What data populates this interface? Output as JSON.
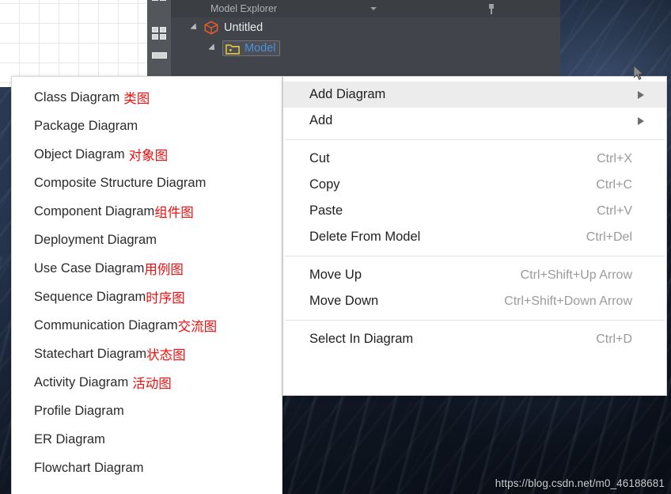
{
  "window": {
    "explorer": {
      "title": "Model Explorer",
      "caret_icon": "chevron-down-icon",
      "pin_icon": "pin-icon",
      "toolbar_icons": [
        "grid-view-icon",
        "grid-view-icon",
        "list-view-icon"
      ],
      "tree": [
        {
          "label": "Untitled",
          "icon": "cube-icon",
          "expanded": true,
          "selected": false
        },
        {
          "label": "Model",
          "icon": "folder-icon",
          "expanded": true,
          "selected": true
        }
      ]
    }
  },
  "diagram_submenu": {
    "name": "Add Diagram submenu",
    "items": [
      {
        "en": "Class Diagram",
        "zh": "类图",
        "space": true
      },
      {
        "en": "Package Diagram",
        "zh": "",
        "space": false
      },
      {
        "en": "Object Diagram",
        "zh": "对象图",
        "space": true
      },
      {
        "en": "Composite Structure Diagram",
        "zh": "",
        "space": false
      },
      {
        "en": "Component Diagram",
        "zh": "组件图",
        "space": false
      },
      {
        "en": "Deployment Diagram",
        "zh": "",
        "space": false
      },
      {
        "en": "Use Case Diagram",
        "zh": "用例图",
        "space": false
      },
      {
        "en": "Sequence Diagram",
        "zh": "时序图",
        "space": false
      },
      {
        "en": "Communication Diagram",
        "zh": "交流图",
        "space": false
      },
      {
        "en": "Statechart Diagram",
        "zh": "状态图",
        "space": false
      },
      {
        "en": "Activity Diagram",
        "zh": "活动图",
        "space": true
      },
      {
        "en": "Profile Diagram",
        "zh": "",
        "space": false
      },
      {
        "en": "ER Diagram",
        "zh": "",
        "space": false
      },
      {
        "en": "Flowchart Diagram",
        "zh": "",
        "space": false
      }
    ]
  },
  "context_menu": {
    "name": "model element context menu",
    "groups": [
      {
        "items": [
          {
            "label": "Add Diagram",
            "shortcut": "",
            "submenu": true,
            "highlighted": true
          },
          {
            "label": "Add",
            "shortcut": "",
            "submenu": true,
            "highlighted": false
          }
        ]
      },
      {
        "items": [
          {
            "label": "Cut",
            "shortcut": "Ctrl+X",
            "submenu": false,
            "highlighted": false
          },
          {
            "label": "Copy",
            "shortcut": "Ctrl+C",
            "submenu": false,
            "highlighted": false
          },
          {
            "label": "Paste",
            "shortcut": "Ctrl+V",
            "submenu": false,
            "highlighted": false
          },
          {
            "label": "Delete From Model",
            "shortcut": "Ctrl+Del",
            "submenu": false,
            "highlighted": false
          }
        ]
      },
      {
        "items": [
          {
            "label": "Move Up",
            "shortcut": "Ctrl+Shift+Up Arrow",
            "submenu": false,
            "highlighted": false
          },
          {
            "label": "Move Down",
            "shortcut": "Ctrl+Shift+Down Arrow",
            "submenu": false,
            "highlighted": false
          }
        ]
      },
      {
        "items": [
          {
            "label": "Select In Diagram",
            "shortcut": "Ctrl+D",
            "submenu": false,
            "highlighted": false
          }
        ]
      }
    ]
  },
  "watermark": {
    "text": "https://blog.csdn.net/m0_46188681"
  },
  "colors": {
    "menu_bg": "#ffffff",
    "menu_highlight": "#ececec",
    "chinese_annotation": "#ef0d0d",
    "shortcut_text": "#9a9a9a",
    "panel_bg": "#41444a",
    "panel_toolbar_bg": "#53565b",
    "tree_selected_text": "#4a90d9",
    "cube_icon": "#e05a2b",
    "folder_icon": "#e8c837"
  }
}
